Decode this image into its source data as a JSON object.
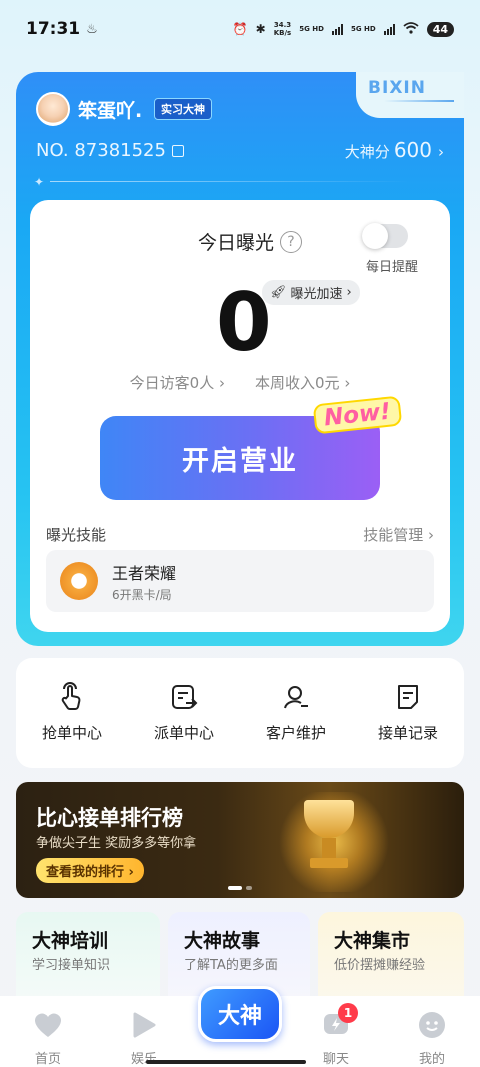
{
  "status_bar": {
    "time": "17:31",
    "speed_value": "34.3",
    "speed_unit": "KB/s",
    "net1": "5G HD",
    "net2": "5G HD",
    "battery": "44"
  },
  "profile": {
    "nickname": "笨蛋吖.",
    "badge": "实习大神",
    "uid": "NO. 87381525",
    "score_label": "大神分",
    "score_value": "600",
    "brand": "BIXIN"
  },
  "exposure": {
    "title": "今日曝光",
    "reminder_label": "每日提醒",
    "reminder_on": false,
    "count": "0",
    "boost_label": "曝光加速",
    "visitors": "今日访客0人",
    "income": "本周收入0元",
    "open_button": "开启营业",
    "now_tag": "Now!",
    "skills_title": "曝光技能",
    "skills_manage": "技能管理",
    "skill": {
      "name": "王者荣耀",
      "desc": "6开黑卡/局"
    }
  },
  "quick_menu": [
    {
      "label": "抢单中心",
      "icon": "tap-hand-icon"
    },
    {
      "label": "派单中心",
      "icon": "dispatch-icon"
    },
    {
      "label": "客户维护",
      "icon": "user-maintain-icon"
    },
    {
      "label": "接单记录",
      "icon": "record-icon"
    }
  ],
  "banner": {
    "title": "比心接单排行榜",
    "subtitle": "争做尖子生 奖励多多等你拿",
    "cta": "查看我的排行"
  },
  "features": [
    {
      "title": "大神培训",
      "desc": "学习接单知识"
    },
    {
      "title": "大神故事",
      "desc": "了解TA的更多面"
    },
    {
      "title": "大神集市",
      "desc": "低价摆摊赚经验"
    }
  ],
  "bottom_nav": {
    "home": "首页",
    "fun": "娱乐",
    "center": "大神",
    "chat": "聊天",
    "chat_badge": "1",
    "me": "我的"
  },
  "colors": {
    "accent": "#1aa8f4",
    "button_start": "#3f86f6",
    "button_end": "#9b5ff5",
    "badge_red": "#ff3b4a"
  }
}
